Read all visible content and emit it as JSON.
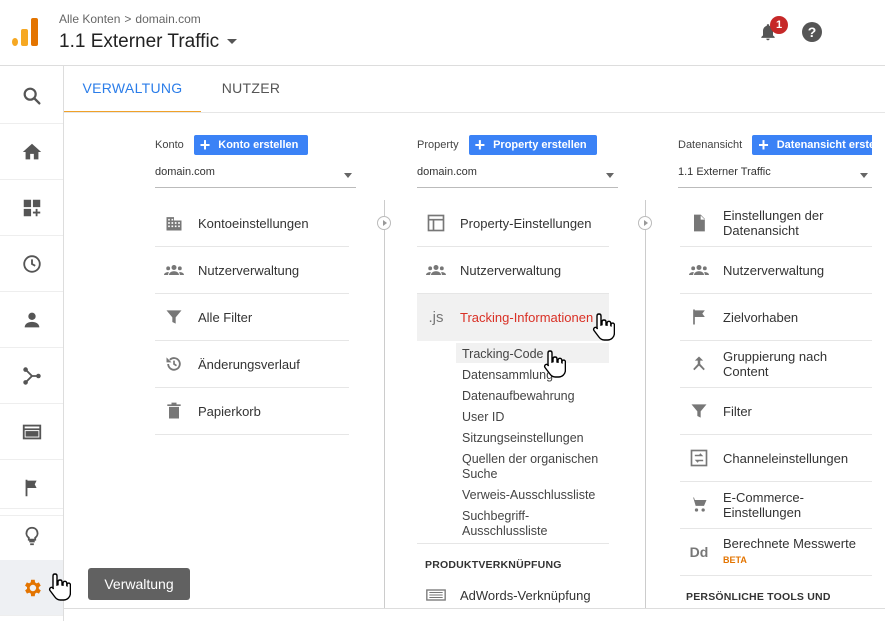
{
  "header": {
    "breadcrumb_root": "Alle Konten",
    "breadcrumb_sep": ">",
    "breadcrumb_account": "domain.com",
    "view_title": "1.1 Externer Traffic",
    "notification_count": "1",
    "help_label": "?"
  },
  "tabs": [
    {
      "label": "VERWALTUNG"
    },
    {
      "label": "NUTZER"
    }
  ],
  "columns": {
    "account": {
      "heading": "Konto",
      "create_label": "Konto erstellen",
      "selected": "domain.com",
      "items": [
        {
          "label": "Kontoeinstellungen",
          "icon": "building-icon"
        },
        {
          "label": "Nutzerverwaltung",
          "icon": "people-icon"
        },
        {
          "label": "Alle Filter",
          "icon": "filter-icon"
        },
        {
          "label": "Änderungsverlauf",
          "icon": "history-icon"
        },
        {
          "label": "Papierkorb",
          "icon": "trash-icon"
        }
      ]
    },
    "property": {
      "heading": "Property",
      "create_label": "Property erstellen",
      "selected": "domain.com",
      "items": [
        {
          "label": "Property-Einstellungen",
          "icon": "window-icon"
        },
        {
          "label": "Nutzerverwaltung",
          "icon": "people-icon"
        },
        {
          "label": "Tracking-Informationen",
          "icon": "js-icon",
          "js_text": ".js"
        }
      ],
      "tracking_sub": [
        "Tracking-Code",
        "Datensammlung",
        "Datenaufbewahrung",
        "User ID",
        "Sitzungseinstellungen",
        "Quellen der organischen Suche",
        "Verweis-Ausschlussliste",
        "Suchbegriff-Ausschlussliste"
      ],
      "section_title": "PRODUKTVERKNÜPFUNG",
      "link_item": "AdWords-Verknüpfung"
    },
    "view": {
      "heading": "Datenansicht",
      "create_label": "Datenansicht erstellen",
      "selected": "1.1 Externer Traffic",
      "items": [
        {
          "label": "Einstellungen der Datenansicht",
          "icon": "document-icon"
        },
        {
          "label": "Nutzerverwaltung",
          "icon": "people-icon"
        },
        {
          "label": "Zielvorhaben",
          "icon": "flag-icon"
        },
        {
          "label": "Gruppierung nach Content",
          "icon": "merge-icon"
        },
        {
          "label": "Filter",
          "icon": "filter-icon"
        },
        {
          "label": "Channeleinstellungen",
          "icon": "channel-icon"
        },
        {
          "label": "E-Commerce-Einstellungen",
          "icon": "cart-icon"
        },
        {
          "label": "Berechnete Messwerte",
          "icon": "dd-icon",
          "badge": "BETA",
          "dd_text": "Dd"
        }
      ],
      "section_title": "PERSÖNLICHE TOOLS UND"
    }
  },
  "tooltip": "Verwaltung",
  "colors": {
    "accent_blue": "#3b82f6",
    "tab_active": "#2b7de9",
    "tab_underline": "#f0a128",
    "link_red": "#d93025",
    "admin_gear": "#e37400"
  }
}
